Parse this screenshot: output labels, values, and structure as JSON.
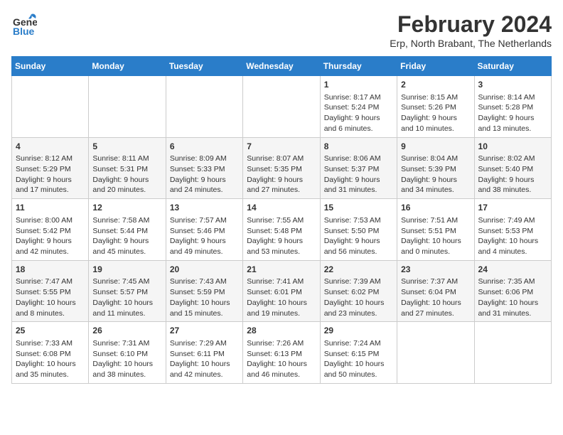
{
  "logo": {
    "line1": "General",
    "line2": "Blue"
  },
  "title": "February 2024",
  "subtitle": "Erp, North Brabant, The Netherlands",
  "days_of_week": [
    "Sunday",
    "Monday",
    "Tuesday",
    "Wednesday",
    "Thursday",
    "Friday",
    "Saturday"
  ],
  "weeks": [
    [
      {
        "day": "",
        "info": ""
      },
      {
        "day": "",
        "info": ""
      },
      {
        "day": "",
        "info": ""
      },
      {
        "day": "",
        "info": ""
      },
      {
        "day": "1",
        "info": "Sunrise: 8:17 AM\nSunset: 5:24 PM\nDaylight: 9 hours\nand 6 minutes."
      },
      {
        "day": "2",
        "info": "Sunrise: 8:15 AM\nSunset: 5:26 PM\nDaylight: 9 hours\nand 10 minutes."
      },
      {
        "day": "3",
        "info": "Sunrise: 8:14 AM\nSunset: 5:28 PM\nDaylight: 9 hours\nand 13 minutes."
      }
    ],
    [
      {
        "day": "4",
        "info": "Sunrise: 8:12 AM\nSunset: 5:29 PM\nDaylight: 9 hours\nand 17 minutes."
      },
      {
        "day": "5",
        "info": "Sunrise: 8:11 AM\nSunset: 5:31 PM\nDaylight: 9 hours\nand 20 minutes."
      },
      {
        "day": "6",
        "info": "Sunrise: 8:09 AM\nSunset: 5:33 PM\nDaylight: 9 hours\nand 24 minutes."
      },
      {
        "day": "7",
        "info": "Sunrise: 8:07 AM\nSunset: 5:35 PM\nDaylight: 9 hours\nand 27 minutes."
      },
      {
        "day": "8",
        "info": "Sunrise: 8:06 AM\nSunset: 5:37 PM\nDaylight: 9 hours\nand 31 minutes."
      },
      {
        "day": "9",
        "info": "Sunrise: 8:04 AM\nSunset: 5:39 PM\nDaylight: 9 hours\nand 34 minutes."
      },
      {
        "day": "10",
        "info": "Sunrise: 8:02 AM\nSunset: 5:40 PM\nDaylight: 9 hours\nand 38 minutes."
      }
    ],
    [
      {
        "day": "11",
        "info": "Sunrise: 8:00 AM\nSunset: 5:42 PM\nDaylight: 9 hours\nand 42 minutes."
      },
      {
        "day": "12",
        "info": "Sunrise: 7:58 AM\nSunset: 5:44 PM\nDaylight: 9 hours\nand 45 minutes."
      },
      {
        "day": "13",
        "info": "Sunrise: 7:57 AM\nSunset: 5:46 PM\nDaylight: 9 hours\nand 49 minutes."
      },
      {
        "day": "14",
        "info": "Sunrise: 7:55 AM\nSunset: 5:48 PM\nDaylight: 9 hours\nand 53 minutes."
      },
      {
        "day": "15",
        "info": "Sunrise: 7:53 AM\nSunset: 5:50 PM\nDaylight: 9 hours\nand 56 minutes."
      },
      {
        "day": "16",
        "info": "Sunrise: 7:51 AM\nSunset: 5:51 PM\nDaylight: 10 hours\nand 0 minutes."
      },
      {
        "day": "17",
        "info": "Sunrise: 7:49 AM\nSunset: 5:53 PM\nDaylight: 10 hours\nand 4 minutes."
      }
    ],
    [
      {
        "day": "18",
        "info": "Sunrise: 7:47 AM\nSunset: 5:55 PM\nDaylight: 10 hours\nand 8 minutes."
      },
      {
        "day": "19",
        "info": "Sunrise: 7:45 AM\nSunset: 5:57 PM\nDaylight: 10 hours\nand 11 minutes."
      },
      {
        "day": "20",
        "info": "Sunrise: 7:43 AM\nSunset: 5:59 PM\nDaylight: 10 hours\nand 15 minutes."
      },
      {
        "day": "21",
        "info": "Sunrise: 7:41 AM\nSunset: 6:01 PM\nDaylight: 10 hours\nand 19 minutes."
      },
      {
        "day": "22",
        "info": "Sunrise: 7:39 AM\nSunset: 6:02 PM\nDaylight: 10 hours\nand 23 minutes."
      },
      {
        "day": "23",
        "info": "Sunrise: 7:37 AM\nSunset: 6:04 PM\nDaylight: 10 hours\nand 27 minutes."
      },
      {
        "day": "24",
        "info": "Sunrise: 7:35 AM\nSunset: 6:06 PM\nDaylight: 10 hours\nand 31 minutes."
      }
    ],
    [
      {
        "day": "25",
        "info": "Sunrise: 7:33 AM\nSunset: 6:08 PM\nDaylight: 10 hours\nand 35 minutes."
      },
      {
        "day": "26",
        "info": "Sunrise: 7:31 AM\nSunset: 6:10 PM\nDaylight: 10 hours\nand 38 minutes."
      },
      {
        "day": "27",
        "info": "Sunrise: 7:29 AM\nSunset: 6:11 PM\nDaylight: 10 hours\nand 42 minutes."
      },
      {
        "day": "28",
        "info": "Sunrise: 7:26 AM\nSunset: 6:13 PM\nDaylight: 10 hours\nand 46 minutes."
      },
      {
        "day": "29",
        "info": "Sunrise: 7:24 AM\nSunset: 6:15 PM\nDaylight: 10 hours\nand 50 minutes."
      },
      {
        "day": "",
        "info": ""
      },
      {
        "day": "",
        "info": ""
      }
    ]
  ]
}
